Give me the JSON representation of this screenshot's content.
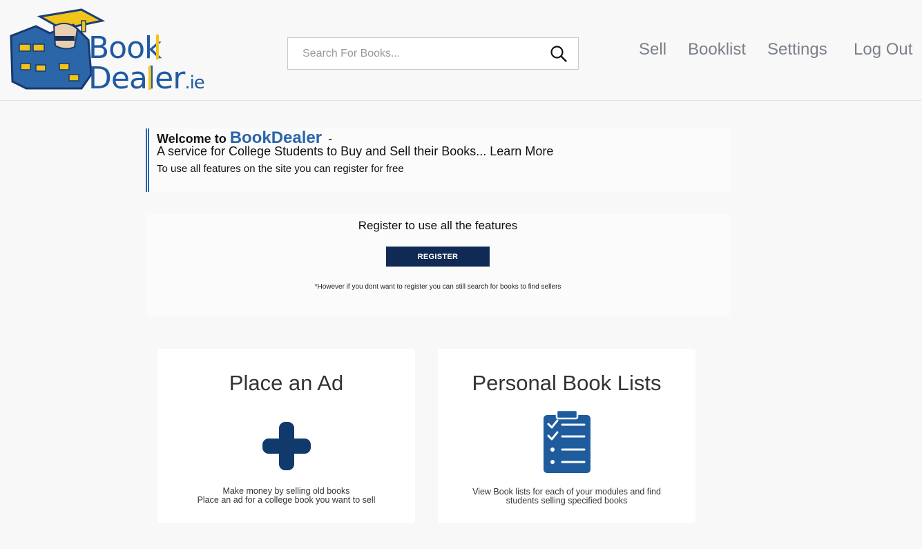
{
  "header": {
    "logo": {
      "word_1": "Book",
      "word_2": "Dealer",
      "suffix": ".ie"
    },
    "search": {
      "placeholder": "Search For Books...",
      "value": ""
    },
    "nav": {
      "sell": "Sell",
      "booklist": "Booklist",
      "settings": "Settings",
      "logout": "Log Out"
    }
  },
  "welcome": {
    "prefix": "Welcome to",
    "brand": "BookDealer",
    "dash": "-",
    "tagline": "A service for College Students to Buy and Sell their Books...",
    "learn_more": "Learn More",
    "register_note": "To use all features on the site you can register for free"
  },
  "register": {
    "title": "Register to use all the features",
    "button": "REGISTER",
    "footnote": "*However if you dont want to register you can still search for books to find sellers"
  },
  "cards": {
    "ad": {
      "title": "Place an Ad",
      "desc_line1": "Make money by selling old books",
      "desc_line2": "Place an ad for a college book you want to sell"
    },
    "lists": {
      "title": "Personal Book Lists",
      "desc_line1": "View Book lists for each of your modules and find",
      "desc_line2": "students selling specified books"
    }
  },
  "icons": {
    "search": "search-icon",
    "plus": "plus-icon",
    "clipboard": "clipboard-checklist-icon"
  },
  "colors": {
    "brand_blue": "#2b66a8",
    "register_button": "#102a55",
    "logo_yellow": "#f2c318",
    "plus_icon": "#0f3a6b",
    "clipboard_icon": "#1e5c9e"
  }
}
